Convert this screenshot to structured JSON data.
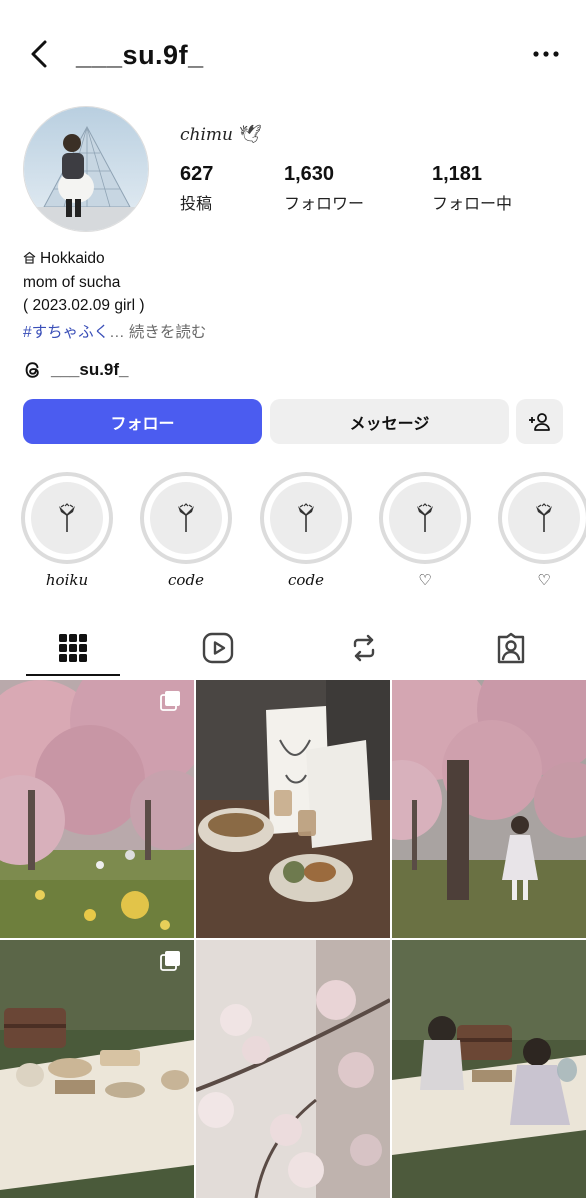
{
  "header": {
    "username": "___su.9f_"
  },
  "profile": {
    "display_name": "chimu",
    "display_name_icon": "bird-icon",
    "stats": [
      {
        "value": "627",
        "label": "投稿"
      },
      {
        "value": "1,630",
        "label": "フォロワー"
      },
      {
        "value": "1,181",
        "label": "フォロー中"
      }
    ]
  },
  "bio": {
    "location_icon": "home-icon",
    "location": "Hokkaido",
    "line2": "mom of sucha",
    "line3": "( 2023.02.09 girl )",
    "hashtag": "#すちゃふく",
    "more": "… 続きを読む"
  },
  "threads": {
    "handle": "___su.9f_"
  },
  "actions": {
    "follow": "フォロー",
    "message": "メッセージ",
    "add_person_icon": "add-person-icon"
  },
  "highlights": [
    {
      "label": "hoiku"
    },
    {
      "label": "code"
    },
    {
      "label": "code"
    },
    {
      "label": "♡"
    },
    {
      "label": "♡"
    }
  ],
  "tabs": [
    "grid-icon",
    "reels-icon",
    "reposts-icon",
    "tagged-icon"
  ],
  "colors": {
    "accent": "#4b5cf0",
    "hashtag": "#3a4fb8"
  }
}
